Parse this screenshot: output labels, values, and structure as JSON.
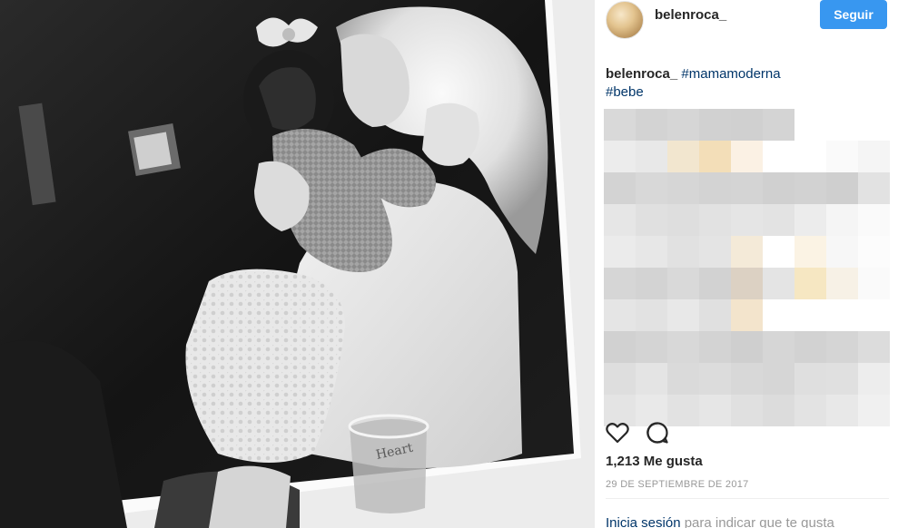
{
  "header": {
    "username": "belenroca_",
    "follow_label": "Seguir",
    "follow_color": "#3897f0"
  },
  "caption": {
    "username": "belenroca_",
    "hashtags": [
      "#mamamoderna",
      "#bebe"
    ],
    "hashtag_color": "#003569"
  },
  "post_image": {
    "description_style": "black-and-white polaroid photo"
  },
  "blurred_comments": {
    "cells": [
      [
        "#d9d9d9",
        "#d3d3d3",
        "#d6d6d6",
        "#d1d1d1",
        "#d0d0d0",
        "#d4d4d4",
        null,
        null,
        null
      ],
      [
        "#ececec",
        "#e8e8e8",
        "#f2e6cf",
        "#f3deb8",
        "#fbf1e4",
        "#ffffff",
        "#ffffff",
        "#fafafa",
        "#f5f5f5"
      ],
      [
        "#d3d3d3",
        "#d8d8d8",
        "#d6d6d6",
        "#d3d3d3",
        "#d4d4d4",
        "#d0d0d0",
        "#d2d2d2",
        "#cfcfcf",
        "#e2e2e2"
      ],
      [
        "#e6e6e6",
        "#e0e0e0",
        "#dedede",
        "#e2e2e2",
        "#e5e5e5",
        "#e3e3e3",
        "#ececec",
        "#f5f5f5",
        "#fafafa"
      ],
      [
        "#ebebeb",
        "#e7e7e7",
        "#e1e1e1",
        "#e4e4e4",
        "#f4ead8",
        "#ffffff",
        "#fbf3e4",
        "#f7f7f7",
        "#fcfcfc"
      ],
      [
        "#d6d6d6",
        "#d3d3d3",
        "#d9d9d9",
        "#d2d2d2",
        "#dcd1c3",
        "#e4e4e4",
        "#f6e7c2",
        "#f7f1e6",
        "#fafafa"
      ],
      [
        "#e5e5e5",
        "#e2e2e2",
        "#e8e8e8",
        "#e0e0e0",
        "#f3e4cc",
        "#ffffff",
        "#ffffff",
        "#ffffff",
        "#ffffff"
      ],
      [
        "#d1d1d1",
        "#d4d4d4",
        "#d8d8d8",
        "#d3d3d3",
        "#cfcfcf",
        "#d6d6d6",
        "#d2d2d2",
        "#d5d5d5",
        "#dcdcdc"
      ],
      [
        "#dedede",
        "#e4e4e4",
        "#dadada",
        "#dcdcdc",
        "#d8d8d8",
        "#d6d6d6",
        "#dfdfdf",
        "#e0e0e0",
        "#ededed"
      ],
      [
        "#e4e4e4",
        "#e9e9e9",
        "#e2e2e2",
        "#e6e6e6",
        "#e0e0e0",
        "#dcdcdc",
        "#e3e3e3",
        "#e8e8e8",
        "#f0f0f0"
      ]
    ]
  },
  "actions": {
    "like_icon": "heart-icon",
    "comment_icon": "comment-icon"
  },
  "likes_text": "1,213 Me gusta",
  "date_text": "29 DE SEPTIEMBRE DE 2017",
  "login_prompt": {
    "link_text": "Inicia sesión",
    "rest_text": " para indicar que te gusta"
  }
}
